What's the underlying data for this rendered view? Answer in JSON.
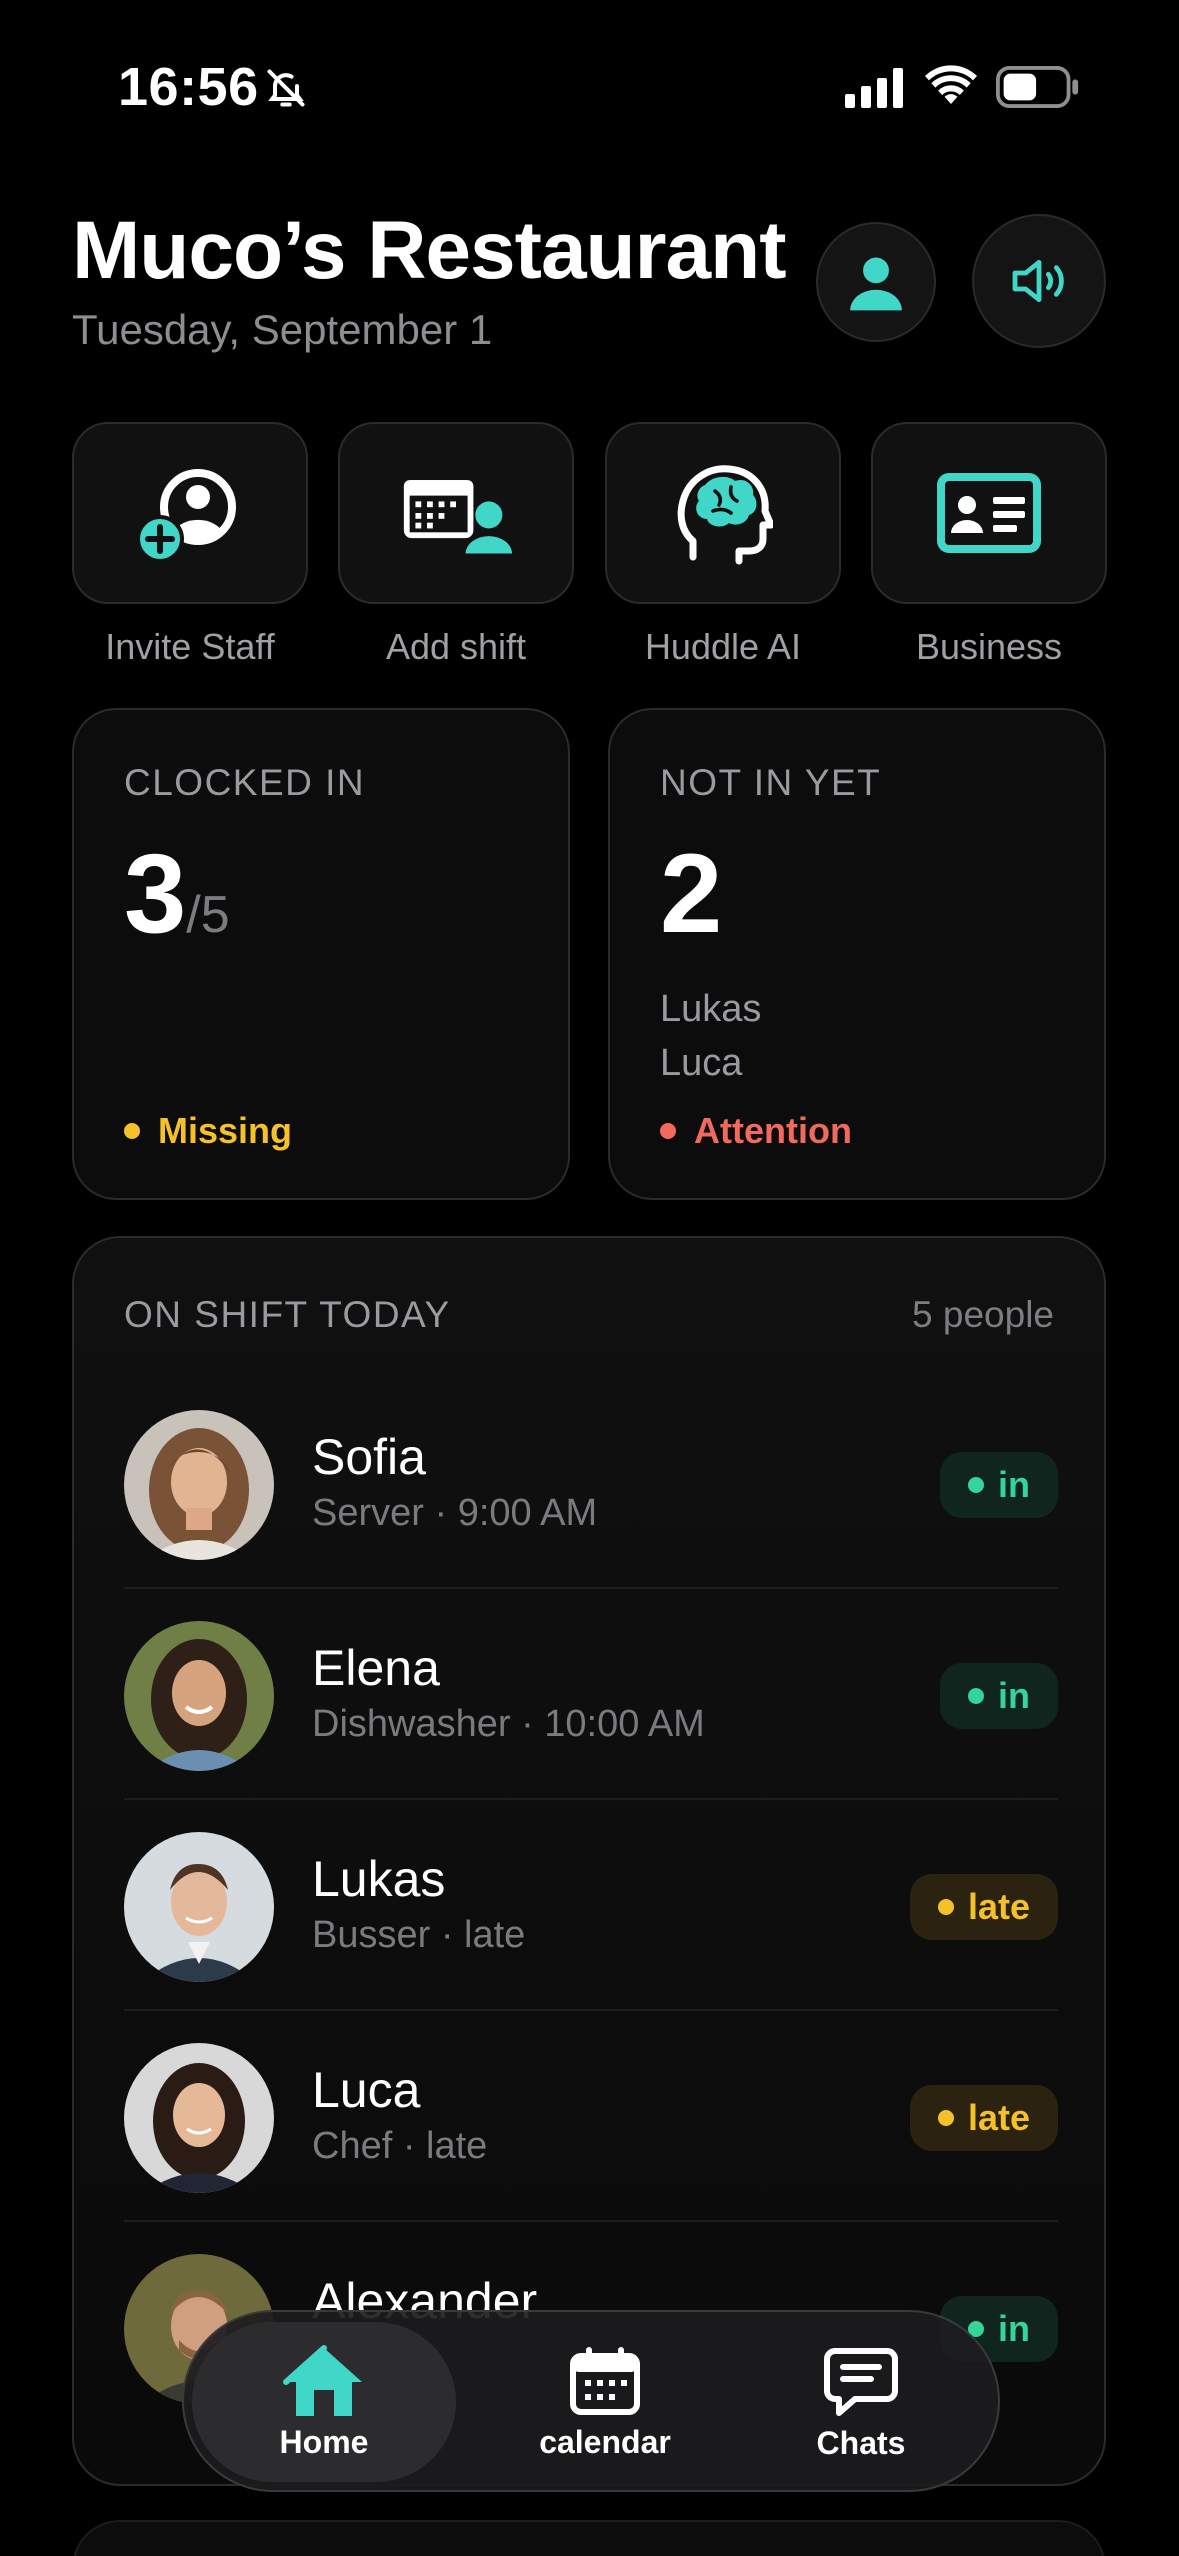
{
  "status_bar": {
    "time": "16:56",
    "icons": [
      "bell-slash-icon",
      "signal-icon",
      "wifi-icon",
      "battery-icon"
    ]
  },
  "header": {
    "title": "Muco’s Restaurant",
    "date": "Tuesday, September 1",
    "buttons": [
      "profile-icon",
      "speaker-icon"
    ]
  },
  "colors": {
    "accent": "#40d6c8",
    "in": "#34d49a",
    "late": "#f6c028",
    "missing": "#f6c028",
    "attention": "#f26a5e"
  },
  "quick_actions": [
    {
      "label": "Invite Staff",
      "icon": "invite-staff-icon"
    },
    {
      "label": "Add shift",
      "icon": "add-shift-icon"
    },
    {
      "label": "Huddle AI",
      "icon": "brain-head-icon"
    },
    {
      "label": "Business",
      "icon": "business-card-icon"
    }
  ],
  "clocked_in": {
    "heading": "CLOCKED IN",
    "count": "3",
    "total": "/5",
    "status": "Missing"
  },
  "not_in_yet": {
    "heading": "NOT IN YET",
    "count": "2",
    "names": [
      "Lukas",
      "Luca"
    ],
    "status": "Attention"
  },
  "shift": {
    "title": "ON SHIFT TODAY",
    "count": "5 people",
    "people": [
      {
        "name": "Sofia",
        "sub": "Server · 9:00 AM",
        "badge": "in"
      },
      {
        "name": "Elena",
        "sub": "Dishwasher · 10:00 AM",
        "badge": "in"
      },
      {
        "name": "Lukas",
        "sub": "Busser · late",
        "badge": "late"
      },
      {
        "name": "Luca",
        "sub": "Chef · late",
        "badge": "late"
      },
      {
        "name": "Alexander",
        "sub": "",
        "badge": "in"
      }
    ]
  },
  "tabs": [
    {
      "label": "Home",
      "icon": "home-icon",
      "active": true
    },
    {
      "label": "calendar",
      "icon": "calendar-icon",
      "active": false
    },
    {
      "label": "Chats",
      "icon": "chat-icon",
      "active": false
    }
  ]
}
